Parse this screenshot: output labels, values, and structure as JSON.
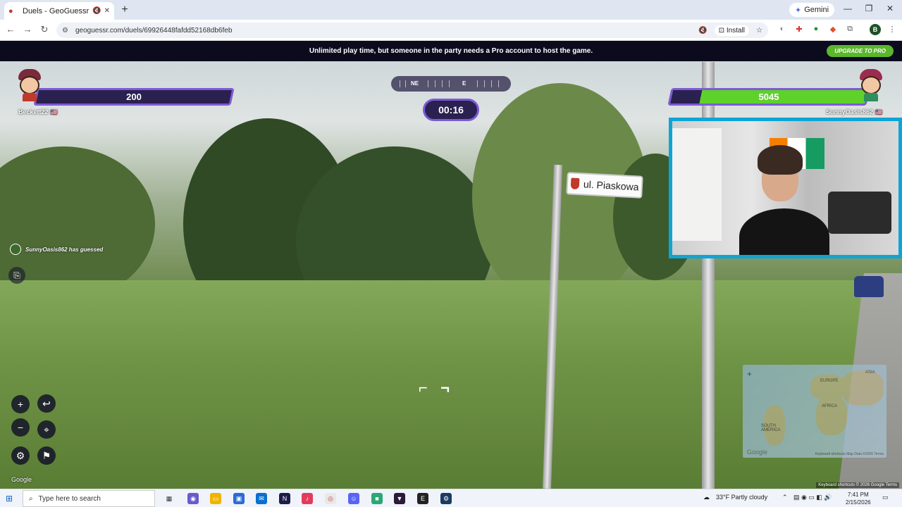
{
  "browser": {
    "tab_title": "Duels - GeoGuessr",
    "url": "geoguessr.com/duels/69926448fafdd52168db6feb",
    "install_label": "Install",
    "gemini_label": "Gemini",
    "profile_initial": "B"
  },
  "game": {
    "banner_text": "Unlimited play time, but someone in the party needs a Pro account to host the game.",
    "upgrade_label": "UPGRADE TO PRO",
    "left_player": {
      "name": "Beckett22",
      "health": "200"
    },
    "right_player": {
      "name": "SunnyOasis862",
      "health": "5045",
      "health_fraction": 0.85
    },
    "compass": {
      "ne": "NE",
      "e": "E"
    },
    "timer": "00:16",
    "guessed_text": "SunnyOasis862 has guessed",
    "street_sign": "ul. Piaskowa",
    "google_label": "Google",
    "credits": "Keyboard shortcuts   © 2026 Google   Terms",
    "map": {
      "europe": "EUROPE",
      "africa": "AFRICA",
      "asia": "ASIA",
      "south_america": "SOUTH AMERICA",
      "footer": "Keyboard shortcuts   Map Data ©2026   Terms",
      "logo": "Google"
    }
  },
  "taskbar": {
    "search_placeholder": "Type here to search",
    "weather": "33°F  Partly cloudy",
    "time": "7:41 PM",
    "date": "2/15/2026"
  },
  "colors": {
    "banner_bg": "#0c0b1e",
    "upgrade_green": "#5bb72b",
    "hud_purple": "#7d5bd6",
    "health_green": "#5ed12b",
    "cam_border": "#0fa4d6"
  }
}
